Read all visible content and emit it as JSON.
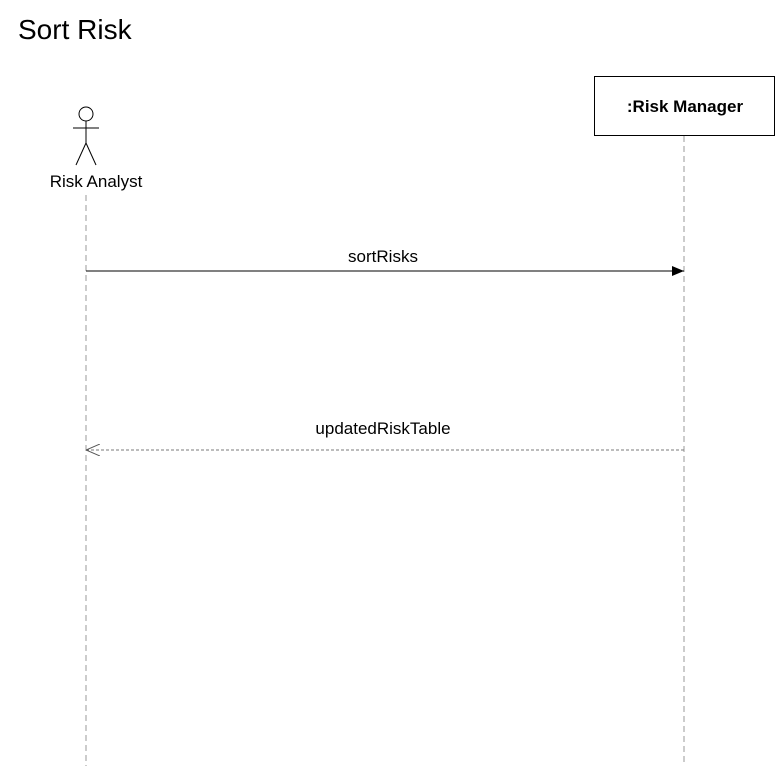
{
  "title": "Sort Risk",
  "actor": {
    "name": "Risk Analyst"
  },
  "object": {
    "name": ":Risk Manager"
  },
  "messages": [
    {
      "label": "sortRisks",
      "kind": "synchronous-call",
      "direction": "actor-to-object"
    },
    {
      "label": "updatedRiskTable",
      "kind": "return",
      "direction": "object-to-actor"
    }
  ]
}
